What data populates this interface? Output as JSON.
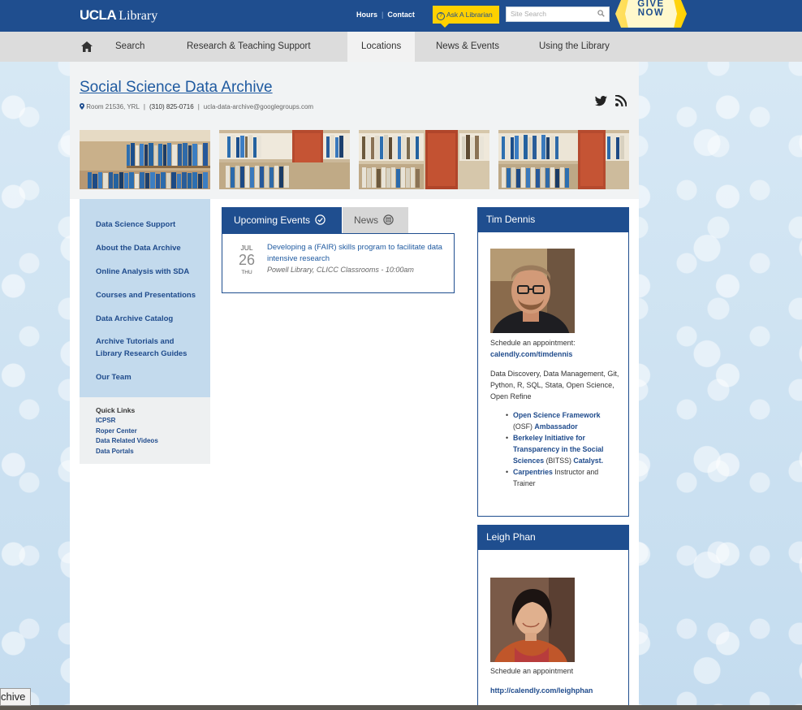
{
  "header": {
    "logo_bold": "UCLA",
    "logo_text": "Library",
    "links": [
      "Hours",
      "Contact"
    ],
    "ask_label": "Ask A Librarian",
    "search_placeholder": "Site Search",
    "give_line1": "GIVE",
    "give_line2": "NOW"
  },
  "nav": {
    "items": [
      "Search",
      "Research & Teaching Support",
      "Locations",
      "News & Events",
      "Using the Library"
    ],
    "active": "Locations"
  },
  "page": {
    "title": "Social Science Data Archive",
    "room": "Room 21536, YRL",
    "phone": "(310) 825-0716",
    "email": "ucla-data-archive@googlegroups.com"
  },
  "sidebar": {
    "items": [
      "Data Science Support",
      "About the Data Archive",
      "Online Analysis with SDA",
      "Courses and Presentations",
      "Data Archive Catalog",
      "Archive Tutorials and Library Research Guides",
      "Our Team"
    ],
    "quick_title": "Quick Links",
    "quick_links": [
      "ICPSR",
      "Roper Center",
      "Data Related Videos",
      "Data Portals"
    ]
  },
  "events": {
    "tab_upcoming": "Upcoming Events",
    "tab_news": "News",
    "items": [
      {
        "month": "JUL",
        "day": "26",
        "dow": "THU",
        "title": "Developing a (FAIR) skills program to facilitate data intensive research",
        "where": "Powell Library, CLICC Classrooms - 10:00am"
      }
    ]
  },
  "staff": [
    {
      "name": "Tim Dennis",
      "schedule_prefix": "Schedule an appointment:",
      "schedule_link": "calendly.com/timdennis",
      "skills": "Data Discovery, Data Management, Git, Python, R, SQL, Stata, Open Science, Open Refine",
      "roles": [
        {
          "link": "Open Science Framework",
          "text": "(OSF)",
          "link2": "Ambassador"
        },
        {
          "link": "Berkeley Initiative for Transparency in the Social Sciences",
          "text": "(BITSS)",
          "link2": "Catalyst."
        },
        {
          "link": "Carpentries",
          "text": "Instructor and Trainer"
        }
      ]
    },
    {
      "name": "Leigh Phan",
      "schedule_prefix": "Schedule an appointment",
      "schedule_link": "http://calendly.com/leighphan"
    }
  ],
  "bottom_tag": "chive",
  "colors": {
    "brand_blue": "#1f4e8f",
    "gold": "#ffd100",
    "sidebar_blue": "#c3daed"
  }
}
